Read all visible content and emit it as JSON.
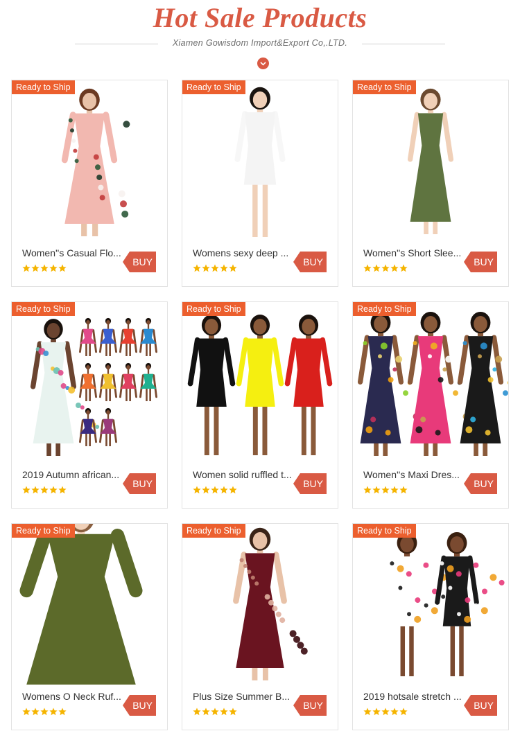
{
  "header": {
    "title": "Hot Sale Products",
    "subtitle": "Xiamen Gowisdom Import&Export Co,.LTD."
  },
  "colors": {
    "accent": "#d95a44",
    "badge": "#ec5f2e",
    "star": "#f5b400",
    "border": "#e3e3e3"
  },
  "products": [
    {
      "badge": "Ready to Ship",
      "name": "Women''s Casual Flo...",
      "buy": "BUY",
      "rating": 5,
      "image": "floral-maxi-dress-photo"
    },
    {
      "badge": "Ready to Ship",
      "name": "Womens sexy deep ...",
      "buy": "BUY",
      "rating": 5,
      "image": "white-bodycon-dress-photo"
    },
    {
      "badge": "Ready to Ship",
      "name": "Women''s Short Slee...",
      "buy": "BUY",
      "rating": 5,
      "image": "olive-maxi-dress-photo"
    },
    {
      "badge": "Ready to Ship",
      "name": "2019 Autumn african...",
      "buy": "BUY",
      "rating": 5,
      "image": "printed-maxi-dresses-collage-photo"
    },
    {
      "badge": "Ready to Ship",
      "name": "Women solid ruffled t...",
      "buy": "BUY",
      "rating": 5,
      "image": "ruffled-dresses-three-colors-photo"
    },
    {
      "badge": "Ready to Ship",
      "name": "Women''s Maxi Dres...",
      "buy": "BUY",
      "rating": 5,
      "image": "chain-print-maxi-dresses-photo"
    },
    {
      "badge": "Ready to Ship",
      "name": "Womens O Neck Ruf...",
      "buy": "BUY",
      "rating": 5,
      "image": "green-ruffle-dress-photo"
    },
    {
      "badge": "Ready to Ship",
      "name": "Plus Size Summer B...",
      "buy": "BUY",
      "rating": 5,
      "image": "burgundy-floral-maxi-photo"
    },
    {
      "badge": "Ready to Ship",
      "name": "2019 hotsale stretch ...",
      "buy": "BUY",
      "rating": 5,
      "image": "graphic-tshirt-dresses-photo"
    }
  ]
}
